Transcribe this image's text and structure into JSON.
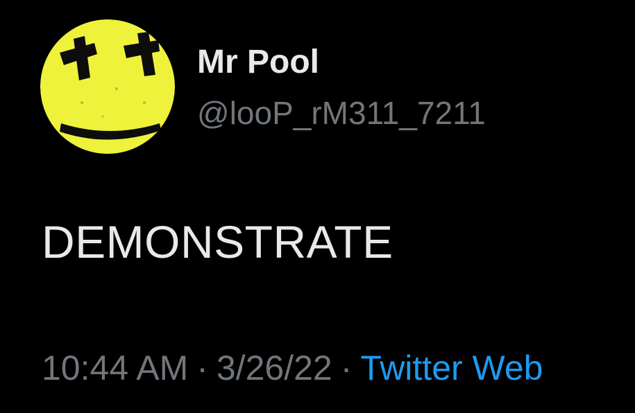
{
  "user": {
    "display_name": "Mr Pool",
    "handle": "@looP_rM311_7211",
    "avatar_icon": "yellow-smiley-face-avatar"
  },
  "tweet": {
    "text": "DEMONSTRATE"
  },
  "meta": {
    "time": "10:44 AM",
    "separator": "·",
    "date": "3/26/22",
    "source": "Twitter Web"
  },
  "colors": {
    "background": "#000000",
    "primary_text": "#e7e9ea",
    "secondary_text": "#71767b",
    "link": "#1d9bf0",
    "avatar_yellow": "#eef23b"
  }
}
